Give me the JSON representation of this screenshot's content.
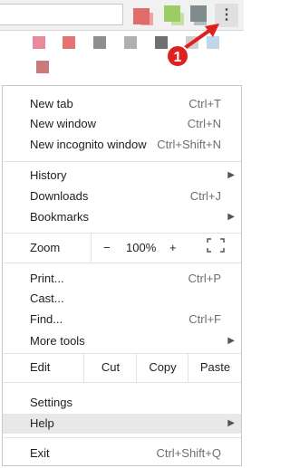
{
  "menu": {
    "new_tab": {
      "label": "New tab",
      "shortcut": "Ctrl+T"
    },
    "new_window": {
      "label": "New window",
      "shortcut": "Ctrl+N"
    },
    "new_incognito": {
      "label": "New incognito window",
      "shortcut": "Ctrl+Shift+N"
    },
    "history": {
      "label": "History"
    },
    "downloads": {
      "label": "Downloads",
      "shortcut": "Ctrl+J"
    },
    "bookmarks": {
      "label": "Bookmarks"
    },
    "zoom": {
      "label": "Zoom",
      "minus": "−",
      "value": "100%",
      "plus": "+"
    },
    "print": {
      "label": "Print...",
      "shortcut": "Ctrl+P"
    },
    "cast": {
      "label": "Cast..."
    },
    "find": {
      "label": "Find...",
      "shortcut": "Ctrl+F"
    },
    "more_tools": {
      "label": "More tools"
    },
    "edit": {
      "label": "Edit",
      "cut": "Cut",
      "copy": "Copy",
      "paste": "Paste"
    },
    "settings": {
      "label": "Settings"
    },
    "help": {
      "label": "Help"
    },
    "exit": {
      "label": "Exit",
      "shortcut": "Ctrl+Shift+Q"
    }
  },
  "toolbar": {
    "menu_icon": "⋮"
  },
  "callout": {
    "number": "1"
  },
  "colors": {
    "callout": "#e02020",
    "highlight": "#e8e8e8"
  },
  "icons": {
    "submenu": "chevron-right-icon",
    "fullscreen": "fullscreen-icon",
    "menu": "three-dots-vertical-icon"
  }
}
